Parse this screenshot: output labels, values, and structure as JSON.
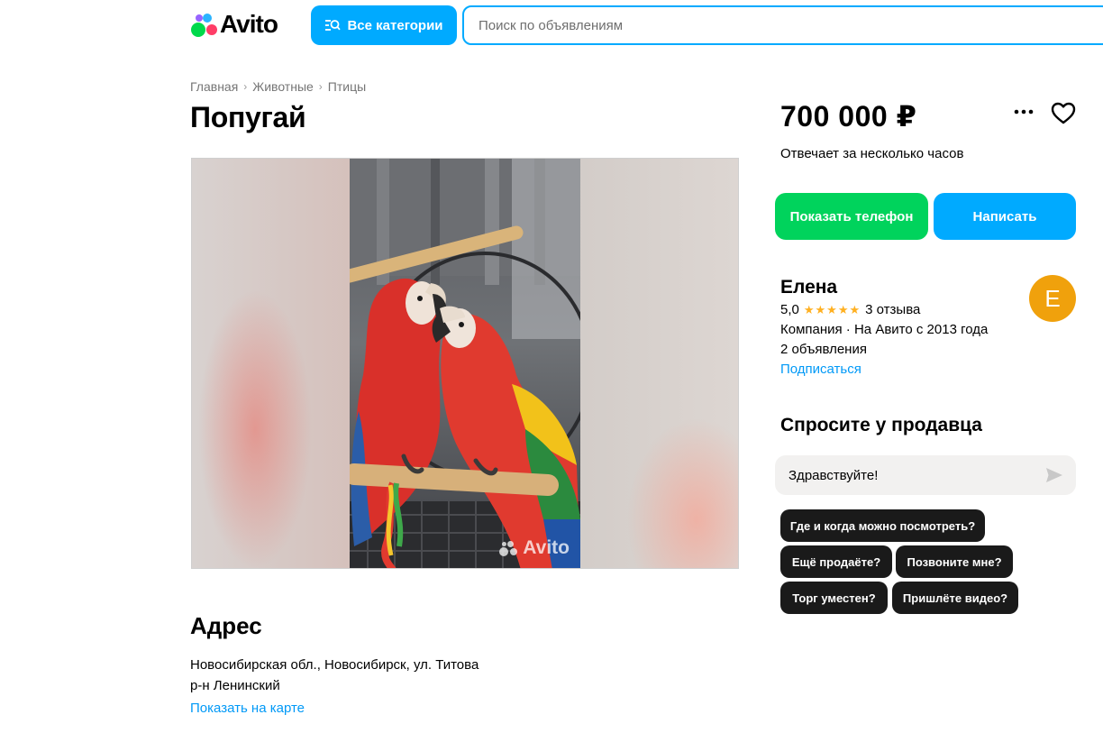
{
  "header": {
    "logo_text": "Avito",
    "categories_button": "Все категории",
    "search_placeholder": "Поиск по объявлениям"
  },
  "breadcrumb": [
    "Главная",
    "Животные",
    "Птицы"
  ],
  "listing": {
    "title": "Попугай",
    "image_watermark": "Avito"
  },
  "address": {
    "heading": "Адрес",
    "line1": "Новосибирская обл., Новосибирск, ул. Титова",
    "line2": "р-н Ленинский",
    "map_link": "Показать на карте"
  },
  "sidebar": {
    "price": "700 000 ₽",
    "response_time": "Отвечает за несколько часов",
    "show_phone_button": "Показать телефон",
    "write_button": "Написать",
    "seller": {
      "name": "Елена",
      "rating": "5,0",
      "stars": "★★★★★",
      "reviews": "3 отзыва",
      "info": "Компания · На Авито с 2013 года",
      "ads_count": "2 объявления",
      "subscribe": "Подписаться",
      "avatar_letter": "Е"
    },
    "ask": {
      "heading": "Спросите у продавца",
      "message_value": "Здравствуйте!",
      "quick_questions": [
        "Где и когда можно посмотреть?",
        "Ещё продаёте?",
        "Позвоните мне?",
        "Торг уместен?",
        "Пришлёте видео?"
      ]
    }
  },
  "colors": {
    "accent_blue": "#00aaff",
    "green": "#00d35c",
    "link": "#0099f7",
    "avatar": "#f0a10c",
    "star": "#ffb021"
  },
  "icons": [
    "search-categories-icon",
    "more-icon",
    "favorite-heart-icon",
    "send-icon"
  ]
}
